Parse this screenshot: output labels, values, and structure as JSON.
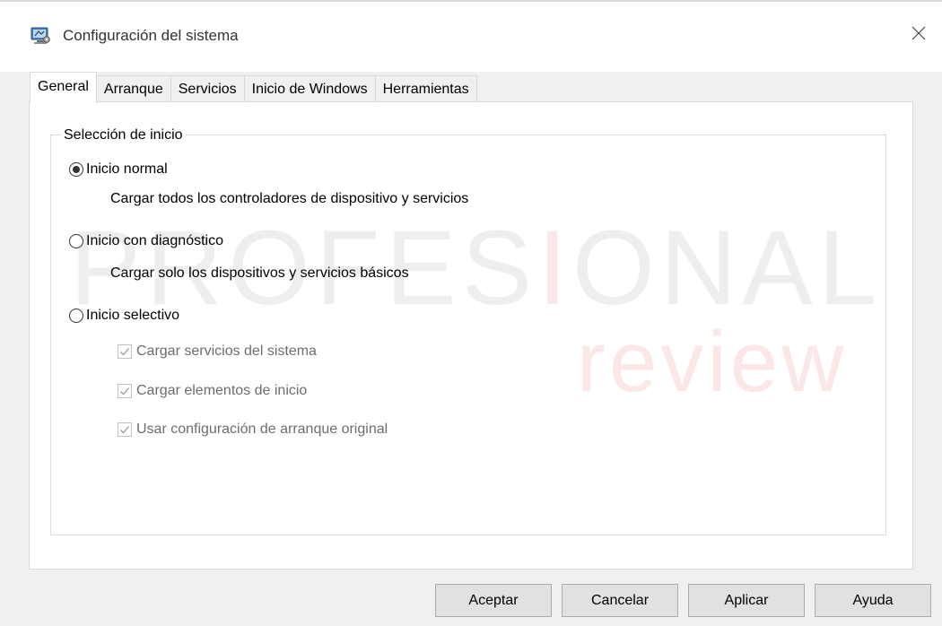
{
  "window": {
    "title": "Configuración del sistema",
    "app_icon": "msconfig-icon",
    "close_icon": "close-icon"
  },
  "tabs": [
    {
      "label": "General",
      "active": true
    },
    {
      "label": "Arranque",
      "active": false
    },
    {
      "label": "Servicios",
      "active": false
    },
    {
      "label": "Inicio de Windows",
      "active": false
    },
    {
      "label": "Herramientas",
      "active": false
    }
  ],
  "startup_selection": {
    "legend": "Selección de inicio",
    "options": [
      {
        "label": "Inicio normal",
        "description": "Cargar todos los controladores de dispositivo y servicios",
        "selected": true
      },
      {
        "label": "Inicio con diagnóstico",
        "description": "Cargar solo los dispositivos y servicios básicos",
        "selected": false
      },
      {
        "label": "Inicio selectivo",
        "selected": false
      }
    ],
    "selective_items": [
      {
        "label": "Cargar servicios del sistema",
        "checked": true,
        "enabled": false
      },
      {
        "label": "Cargar elementos de inicio",
        "checked": true,
        "enabled": false
      },
      {
        "label": "Usar configuración de arranque original",
        "checked": true,
        "enabled": false
      }
    ]
  },
  "watermark": {
    "main": "PROFESIONAL",
    "sub": "review"
  },
  "buttons": {
    "ok": "Aceptar",
    "cancel": "Cancelar",
    "apply": "Aplicar",
    "help": "Ayuda"
  },
  "colors": {
    "window_bg": "#f0f0f0",
    "panel_bg": "#ffffff",
    "button_bg": "#e1e1e1",
    "disabled_text": "#6d6d6d",
    "watermark_accent": "#e0413a"
  }
}
